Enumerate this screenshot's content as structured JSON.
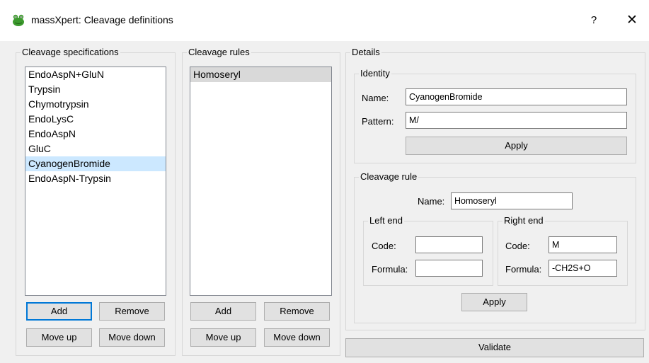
{
  "window": {
    "title": "massXpert: Cleavage definitions",
    "help_label": "?",
    "close_label": "✕",
    "app_icon": "frog-icon"
  },
  "specs": {
    "group_title": "Cleavage specifications",
    "items": [
      {
        "label": "EndoAspN+GluN"
      },
      {
        "label": "Trypsin"
      },
      {
        "label": "Chymotrypsin"
      },
      {
        "label": "EndoLysC"
      },
      {
        "label": "EndoAspN"
      },
      {
        "label": "GluC"
      },
      {
        "label": "CyanogenBromide",
        "selected": true
      },
      {
        "label": "EndoAspN-Trypsin"
      }
    ],
    "add_label": "Add",
    "remove_label": "Remove",
    "move_up_label": "Move up",
    "move_down_label": "Move down"
  },
  "rules": {
    "group_title": "Cleavage rules",
    "items": [
      {
        "label": "Homoseryl",
        "selected": true
      }
    ],
    "add_label": "Add",
    "remove_label": "Remove",
    "move_up_label": "Move up",
    "move_down_label": "Move down"
  },
  "details": {
    "group_title": "Details",
    "identity": {
      "group_title": "Identity",
      "name_label": "Name:",
      "name_value": "CyanogenBromide",
      "pattern_label": "Pattern:",
      "pattern_value": "M/",
      "apply_label": "Apply"
    },
    "rule": {
      "group_title": "Cleavage rule",
      "name_label": "Name:",
      "name_value": "Homoseryl",
      "left": {
        "group_title": "Left end",
        "code_label": "Code:",
        "code_value": "",
        "formula_label": "Formula:",
        "formula_value": ""
      },
      "right": {
        "group_title": "Right end",
        "code_label": "Code:",
        "code_value": "M",
        "formula_label": "Formula:",
        "formula_value": "-CH2S+O"
      },
      "apply_label": "Apply"
    }
  },
  "validate_label": "Validate"
}
